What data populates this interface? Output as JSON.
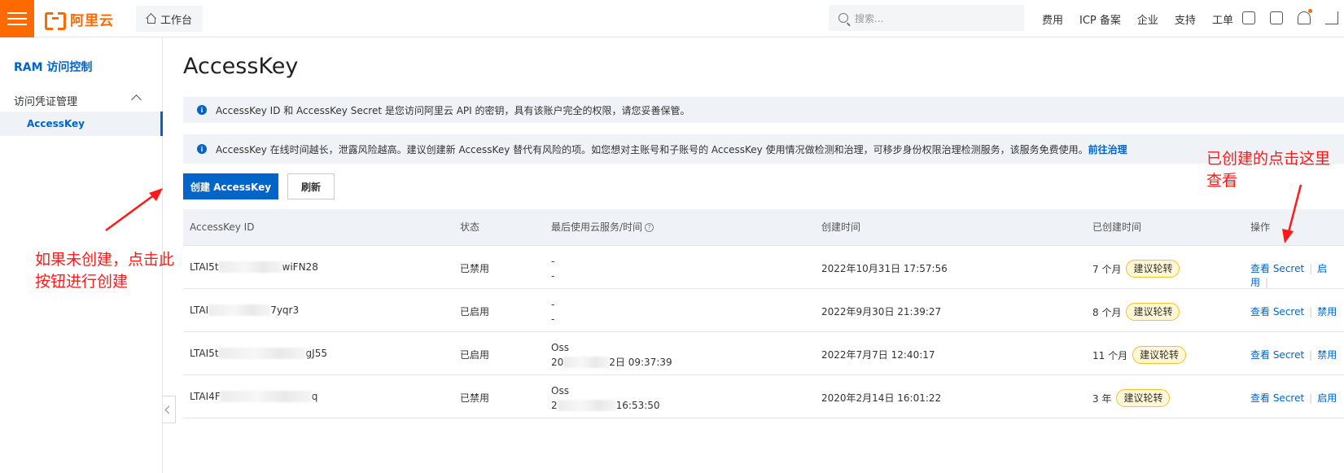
{
  "topbar": {
    "logo_text": "阿里云",
    "workbench": "工作台",
    "search_placeholder": "搜索...",
    "links": [
      "费用",
      "ICP 备案",
      "企业",
      "支持",
      "工单"
    ]
  },
  "sidebar": {
    "title": "RAM 访问控制",
    "group": "访问凭证管理",
    "active_item": "AccessKey"
  },
  "page": {
    "title": "AccessKey",
    "alert1": "AccessKey ID 和 AccessKey Secret 是您访问阿里云 API 的密钥，具有该账户完全的权限，请您妥善保管。",
    "alert2": "AccessKey 在线时间越长，泄露风险越高。建议创建新 AccessKey 替代有风险的项。如您想对主账号和子账号的 AccessKey 使用情况做检测和治理，可移步身份权限治理检测服务，该服务免费使用。",
    "alert2_link": "前往治理",
    "create_button": "创建 AccessKey",
    "refresh_button": "刷新"
  },
  "table": {
    "headers": {
      "id": "AccessKey ID",
      "status": "状态",
      "last_used": "最后使用云服务/时间",
      "created": "创建时间",
      "age": "已创建时间",
      "ops": "操作"
    },
    "rows": [
      {
        "id_prefix": "LTAI5t",
        "id_suffix": "wiFN28",
        "status": "已禁用",
        "last_line1": "-",
        "last_line2_prefix": "",
        "last_line2_suffix": "-",
        "created": "2022年10月31日 17:57:56",
        "age": "7 个月",
        "badge": "建议轮转",
        "op_view": "查看 Secret",
        "op_toggle": "启用"
      },
      {
        "id_prefix": "LTAI",
        "id_suffix": "7yqr3",
        "status": "已启用",
        "last_line1": "-",
        "last_line2_prefix": "",
        "last_line2_suffix": "-",
        "created": "2022年9月30日 21:39:27",
        "age": "8 个月",
        "badge": "建议轮转",
        "op_view": "查看 Secret",
        "op_toggle": "禁用"
      },
      {
        "id_prefix": "LTAI5t",
        "id_suffix": "gJ55",
        "status": "已启用",
        "last_line1": "Oss",
        "last_line2_prefix": "20",
        "last_line2_suffix": "2日 09:37:39",
        "created": "2022年7月7日 12:40:17",
        "age": "11 个月",
        "badge": "建议轮转",
        "op_view": "查看 Secret",
        "op_toggle": "禁用"
      },
      {
        "id_prefix": "LTAI4F",
        "id_suffix": "q",
        "status": "已禁用",
        "last_line1": "Oss",
        "last_line2_prefix": "2",
        "last_line2_suffix": " 16:53:50",
        "created": "2020年2月14日 16:01:22",
        "age": "3 年",
        "badge": "建议轮转",
        "op_view": "查看 Secret",
        "op_toggle": "启用"
      }
    ]
  },
  "annotations": {
    "left": "如果未创建，点击此按钮进行创建",
    "right": "已创建的点击这里查看"
  },
  "colors": {
    "brand_orange": "#ff6a00",
    "primary_blue": "#0064c8",
    "annotation_red": "#ff1a1a",
    "badge_yellow": "#f5c028"
  },
  "icons": [
    "menu-icon",
    "home-icon",
    "search-icon",
    "settings-code-icon",
    "terminal-icon",
    "bell-icon",
    "cart-icon",
    "chevron-up-icon",
    "info-icon",
    "question-icon",
    "collapse-left-icon"
  ]
}
